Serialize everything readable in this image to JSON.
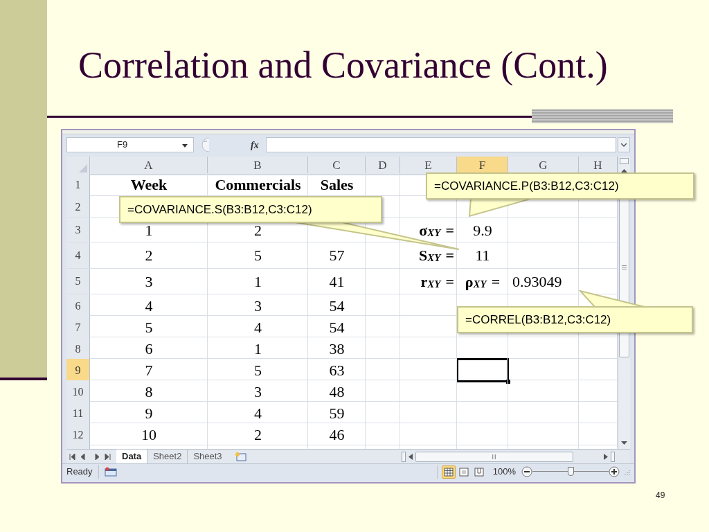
{
  "slide": {
    "title": "Correlation and Covariance (Cont.)",
    "page_number": "49"
  },
  "spreadsheet": {
    "name_box": "F9",
    "function_label": "fx",
    "columns": [
      {
        "label": "A",
        "selected": false
      },
      {
        "label": "B",
        "selected": false
      },
      {
        "label": "C",
        "selected": false
      },
      {
        "label": "D",
        "selected": false
      },
      {
        "label": "E",
        "selected": false
      },
      {
        "label": "F",
        "selected": true
      },
      {
        "label": "G",
        "selected": false
      },
      {
        "label": "H",
        "selected": false
      }
    ],
    "rows": [
      {
        "label": "1",
        "selected": false,
        "kind": "header",
        "cells": {
          "A": "Week",
          "B": "Commercials",
          "C": "Sales"
        }
      },
      {
        "label": "2",
        "selected": false,
        "kind": "data"
      },
      {
        "label": "3",
        "selected": false,
        "kind": "data",
        "cells": {
          "A": "1",
          "B": "2",
          "E": "**σ**$_{XY}$ **=**",
          "F": "9.9"
        }
      },
      {
        "label": "4",
        "selected": false,
        "kind": "data",
        "cells": {
          "A": "2",
          "B": "5",
          "C": "57",
          "E": "**S**$_{XY}$ **=**",
          "F": "11"
        }
      },
      {
        "label": "5",
        "selected": false,
        "kind": "data",
        "cells": {
          "A": "3",
          "B": "1",
          "C": "41",
          "E": "**r**$_{XY}$ **=**",
          "F": "**ρ**$_{XY}$ **=**",
          "G": "0.93049"
        }
      },
      {
        "label": "6",
        "selected": false,
        "kind": "data",
        "cells": {
          "A": "4",
          "B": "3",
          "C": "54"
        }
      },
      {
        "label": "7",
        "selected": false,
        "kind": "data",
        "cells": {
          "A": "5",
          "B": "4",
          "C": "54"
        }
      },
      {
        "label": "8",
        "selected": false,
        "kind": "data",
        "cells": {
          "A": "6",
          "B": "1",
          "C": "38"
        }
      },
      {
        "label": "9",
        "selected": true,
        "kind": "data",
        "cells": {
          "A": "7",
          "B": "5",
          "C": "63"
        }
      },
      {
        "label": "10",
        "selected": false,
        "kind": "data",
        "cells": {
          "A": "8",
          "B": "3",
          "C": "48"
        }
      },
      {
        "label": "11",
        "selected": false,
        "kind": "data",
        "cells": {
          "A": "9",
          "B": "4",
          "C": "59"
        }
      },
      {
        "label": "12",
        "selected": false,
        "kind": "data",
        "cells": {
          "A": "10",
          "B": "2",
          "C": "46"
        }
      }
    ],
    "sheet_tabs": [
      {
        "label": "Data",
        "selected": true
      },
      {
        "label": "Sheet2",
        "selected": false
      },
      {
        "label": "Sheet3",
        "selected": false
      }
    ],
    "status_bar": {
      "mode": "Ready",
      "views": [
        {
          "kind": "normal",
          "selected": true
        },
        {
          "kind": "page-layout",
          "selected": false
        },
        {
          "kind": "page-break",
          "selected": false
        }
      ],
      "zoom": "100%",
      "zoom_slider": {
        "level": 0.5
      }
    }
  },
  "callouts": [
    {
      "text": "=COVARIANCE.P(B3:B12,C3:C12)"
    },
    {
      "text": "=COVARIANCE.S(B3:B12,C3:C12)"
    },
    {
      "text": "=CORREL(B3:B12,C3:C12)"
    }
  ]
}
